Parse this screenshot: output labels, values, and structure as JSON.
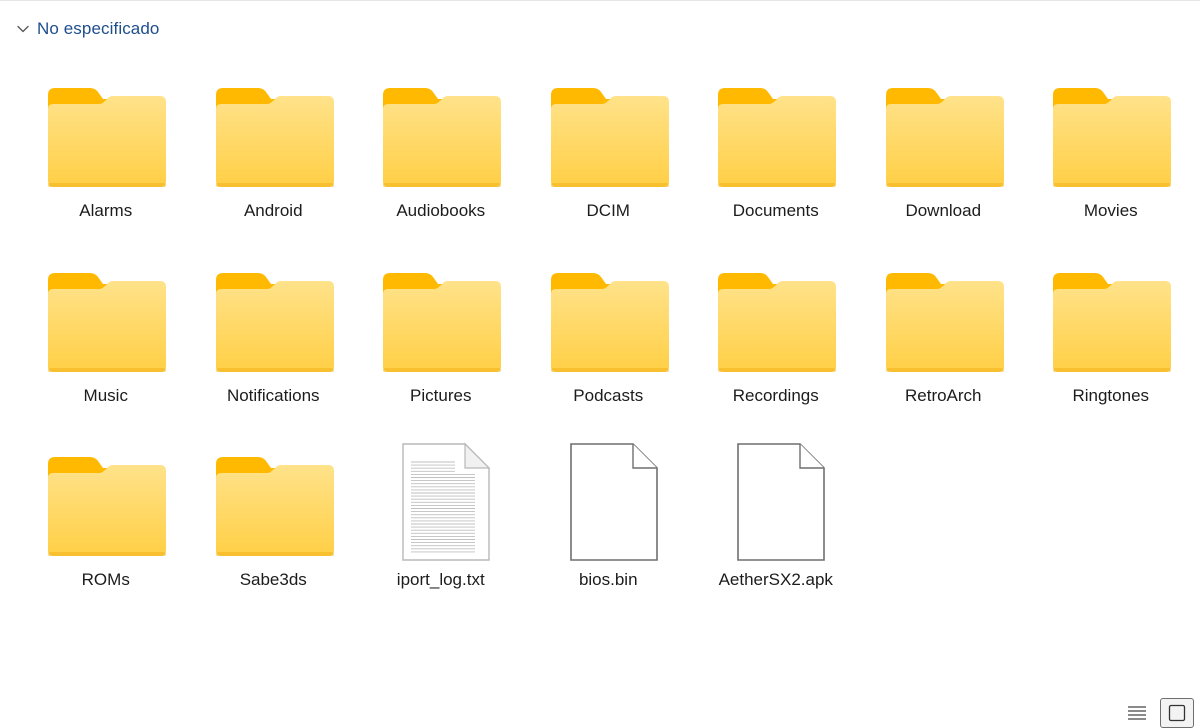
{
  "group": {
    "label": "No especificado",
    "icon": "chevron-down-icon"
  },
  "items": [
    {
      "name": "Alarms",
      "kind": "folder"
    },
    {
      "name": "Android",
      "kind": "folder"
    },
    {
      "name": "Audiobooks",
      "kind": "folder"
    },
    {
      "name": "DCIM",
      "kind": "folder"
    },
    {
      "name": "Documents",
      "kind": "folder"
    },
    {
      "name": "Download",
      "kind": "folder"
    },
    {
      "name": "Movies",
      "kind": "folder"
    },
    {
      "name": "Music",
      "kind": "folder"
    },
    {
      "name": "Notifications",
      "kind": "folder"
    },
    {
      "name": "Pictures",
      "kind": "folder"
    },
    {
      "name": "Podcasts",
      "kind": "folder"
    },
    {
      "name": "Recordings",
      "kind": "folder"
    },
    {
      "name": "RetroArch",
      "kind": "folder"
    },
    {
      "name": "Ringtones",
      "kind": "folder"
    },
    {
      "name": "ROMs",
      "kind": "folder"
    },
    {
      "name": "Sabe3ds",
      "kind": "folder"
    },
    {
      "name": "iport_log.txt",
      "kind": "text-file"
    },
    {
      "name": "bios.bin",
      "kind": "file"
    },
    {
      "name": "AetherSX2.apk",
      "kind": "file"
    }
  ],
  "view_toggles": [
    {
      "icon": "details-view-icon",
      "active": false
    },
    {
      "icon": "large-icons-view-icon",
      "active": true
    }
  ],
  "colors": {
    "accent_text": "#1f4e8c",
    "folder_body": "#ffd960",
    "folder_tab": "#ffb900"
  }
}
